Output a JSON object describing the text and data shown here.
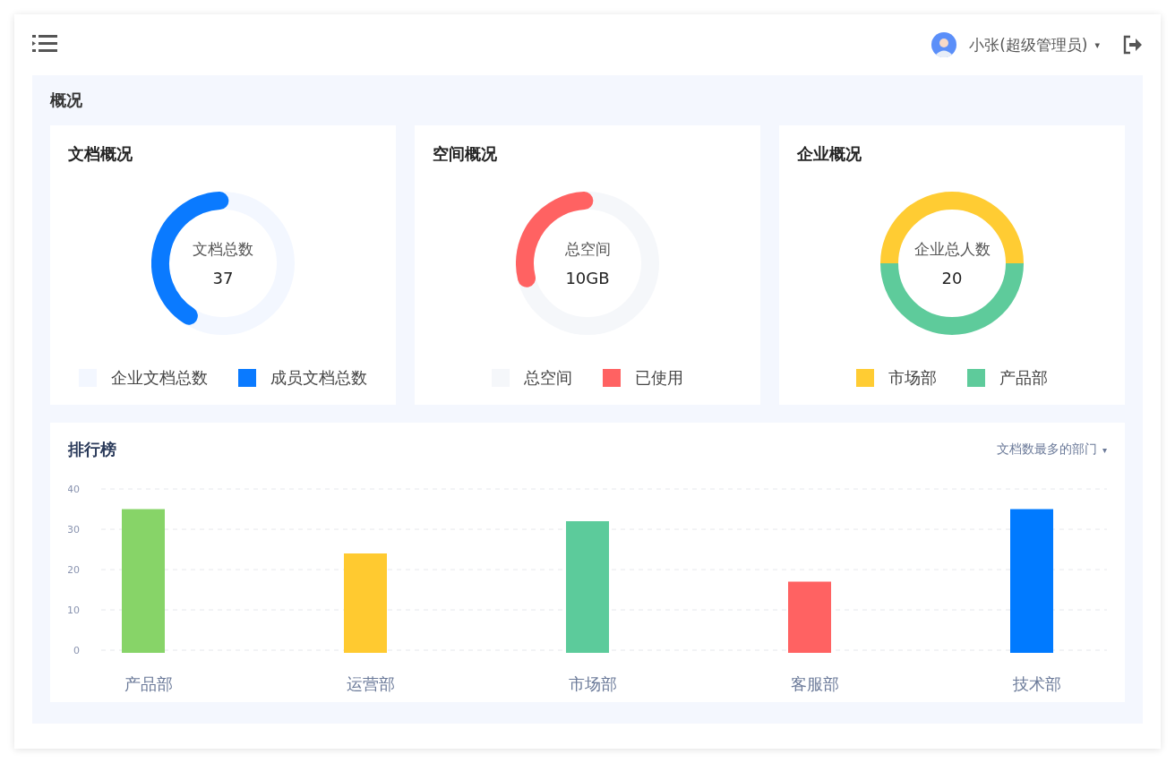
{
  "header": {
    "user_name": "小张(超级管理员)",
    "user_caret": "▾"
  },
  "overview": {
    "title": "概况",
    "cards": [
      {
        "title": "文档概况",
        "kind": "progress",
        "center_label": "文档总数",
        "center_value": "37",
        "segments": [
          {
            "label": "企业文档总数",
            "color": "#f3f7ff"
          },
          {
            "label": "成员文档总数",
            "color": "#0a7aff"
          }
        ]
      },
      {
        "title": "空间概况",
        "kind": "progress",
        "center_label": "总空间",
        "center_value": "10GB",
        "segments": [
          {
            "label": "总空间",
            "color": "#f5f7fa"
          },
          {
            "label": "已使用",
            "color": "#ff6262"
          }
        ]
      },
      {
        "title": "企业概况",
        "kind": "split",
        "center_label": "企业总人数",
        "center_value": "20",
        "segments": [
          {
            "label": "市场部",
            "color": "#ffcc33"
          },
          {
            "label": "产品部",
            "color": "#5ecb9b"
          }
        ]
      }
    ]
  },
  "ranking": {
    "title": "排行榜",
    "filter": "文档数最多的部门",
    "filter_caret": "▾",
    "chart_data": {
      "type": "bar",
      "categories": [
        "产品部",
        "运营部",
        "市场部",
        "客服部",
        "技术部"
      ],
      "stacked": true,
      "grid": true,
      "series": [
        {
          "color": "#87d468",
          "values": [
            35,
            null,
            null,
            null,
            null
          ]
        },
        {
          "color": "#ffca30",
          "values": [
            null,
            24,
            null,
            null,
            null
          ]
        },
        {
          "color": "#5ccb9b",
          "values": [
            null,
            null,
            32,
            null,
            null
          ]
        },
        {
          "color": "#ff6262",
          "values": [
            null,
            null,
            null,
            17,
            null
          ]
        },
        {
          "color": "#007aff",
          "values": [
            null,
            null,
            null,
            null,
            35
          ]
        }
      ],
      "ylim": [
        0,
        40
      ],
      "yticks": [
        0,
        10,
        20,
        30,
        40
      ]
    }
  }
}
